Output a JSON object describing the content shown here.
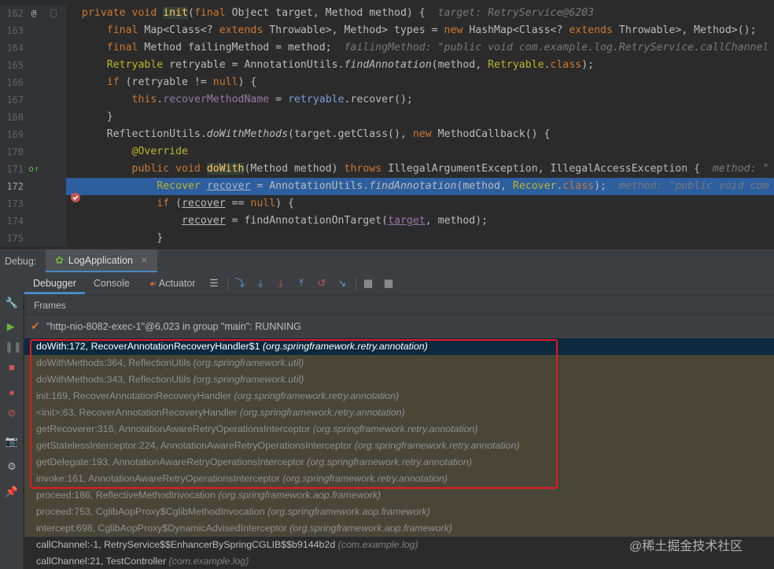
{
  "editor": {
    "lines": [
      {
        "num": "162",
        "marker": "@",
        "current": false
      },
      {
        "num": "163",
        "marker": "",
        "current": false
      },
      {
        "num": "164",
        "marker": "",
        "current": false
      },
      {
        "num": "165",
        "marker": "",
        "current": false
      },
      {
        "num": "166",
        "marker": "",
        "current": false
      },
      {
        "num": "167",
        "marker": "",
        "current": false
      },
      {
        "num": "168",
        "marker": "",
        "current": false
      },
      {
        "num": "169",
        "marker": "",
        "current": false
      },
      {
        "num": "170",
        "marker": "",
        "current": false
      },
      {
        "num": "171",
        "marker": "override",
        "current": false
      },
      {
        "num": "172",
        "marker": "breakpoint",
        "current": true
      },
      {
        "num": "173",
        "marker": "",
        "current": false
      },
      {
        "num": "174",
        "marker": "",
        "current": false
      },
      {
        "num": "175",
        "marker": "",
        "current": false
      }
    ],
    "hints": {
      "l162": "target: RetryService@6203",
      "l164": "failingMethod: \"public void com.example.log.RetryService.callChannel",
      "l171": "method: \"",
      "l172": "method: \"public void com"
    }
  },
  "debug": {
    "label": "Debug:",
    "session_tab": "LogApplication",
    "tabs": [
      "Debugger",
      "Console",
      "Actuator"
    ],
    "frames_label": "Frames",
    "thread": "\"http-nio-8082-exec-1\"@6,023 in group \"main\": RUNNING",
    "frames": [
      {
        "method": "doWith:172, RecoverAnnotationRecoveryHandler$1",
        "pkg": "(org.springframework.retry.annotation)",
        "style": "sel"
      },
      {
        "method": "doWithMethods:364, ReflectionUtils",
        "pkg": "(org.springframework.util)",
        "style": "lib"
      },
      {
        "method": "doWithMethods:343, ReflectionUtils",
        "pkg": "(org.springframework.util)",
        "style": "lib"
      },
      {
        "method": "init:169, RecoverAnnotationRecoveryHandler",
        "pkg": "(org.springframework.retry.annotation)",
        "style": "lib"
      },
      {
        "method": "<init>:63, RecoverAnnotationRecoveryHandler",
        "pkg": "(org.springframework.retry.annotation)",
        "style": "lib"
      },
      {
        "method": "getRecoverer:316, AnnotationAwareRetryOperationsInterceptor",
        "pkg": "(org.springframework.retry.annotation)",
        "style": "lib"
      },
      {
        "method": "getStatelessInterceptor:224, AnnotationAwareRetryOperationsInterceptor",
        "pkg": "(org.springframework.retry.annotation)",
        "style": "lib"
      },
      {
        "method": "getDelegate:193, AnnotationAwareRetryOperationsInterceptor",
        "pkg": "(org.springframework.retry.annotation)",
        "style": "lib"
      },
      {
        "method": "invoke:161, AnnotationAwareRetryOperationsInterceptor",
        "pkg": "(org.springframework.retry.annotation)",
        "style": "lib"
      },
      {
        "method": "proceed:186, ReflectiveMethodInvocation",
        "pkg": "(org.springframework.aop.framework)",
        "style": "lib"
      },
      {
        "method": "proceed:753, CglibAopProxy$CglibMethodInvocation",
        "pkg": "(org.springframework.aop.framework)",
        "style": "lib"
      },
      {
        "method": "intercept:698, CglibAopProxy$DynamicAdvisedInterceptor",
        "pkg": "(org.springframework.aop.framework)",
        "style": "lib"
      },
      {
        "method": "callChannel:-1, RetryService$$EnhancerBySpringCGLIB$$b9144b2d",
        "pkg": "(com.example.log)",
        "style": "user"
      },
      {
        "method": "callChannel:21, TestController",
        "pkg": "(com.example.log)",
        "style": "user"
      }
    ]
  },
  "watermark": "@稀土掘金技术社区",
  "colors": {
    "highlight_box": "#e5191d",
    "current_line": "#2d5e9e",
    "selected_frame": "#0d293e",
    "library_frame": "#4a4637"
  }
}
